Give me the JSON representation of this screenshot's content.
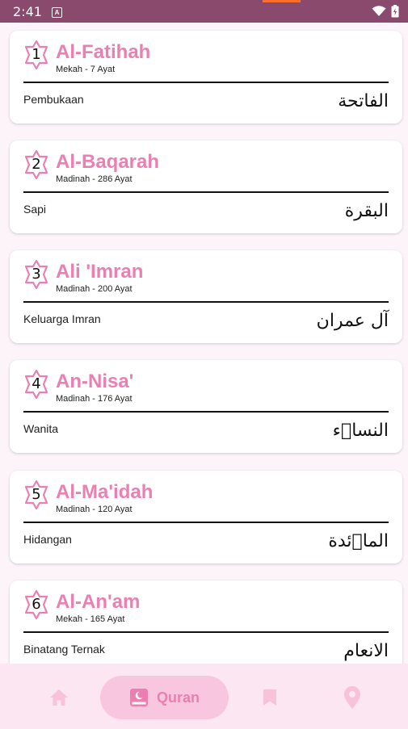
{
  "status_bar": {
    "time": "2:41",
    "notification_icon": "A"
  },
  "surahs": [
    {
      "number": "1",
      "name": "Al-Fatihah",
      "info": "Mekah - 7 Ayat",
      "meaning": "Pembukaan",
      "arabic": "الفاتحة"
    },
    {
      "number": "2",
      "name": "Al-Baqarah",
      "info": "Madinah - 286 Ayat",
      "meaning": "Sapi",
      "arabic": "البقرة"
    },
    {
      "number": "3",
      "name": "Ali 'Imran",
      "info": "Madinah - 200 Ayat",
      "meaning": "Keluarga Imran",
      "arabic": "آل عمران"
    },
    {
      "number": "4",
      "name": "An-Nisa'",
      "info": "Madinah - 176 Ayat",
      "meaning": "Wanita",
      "arabic": "النساۤء"
    },
    {
      "number": "5",
      "name": "Al-Ma'idah",
      "info": "Madinah - 120 Ayat",
      "meaning": "Hidangan",
      "arabic": "الماۤئدة"
    },
    {
      "number": "6",
      "name": "Al-An'am",
      "info": "Mekah - 165 Ayat",
      "meaning": "Binatang Ternak",
      "arabic": "الانعام"
    }
  ],
  "nav": {
    "items": [
      {
        "icon": "home-icon"
      },
      {
        "icon": "quran-book-icon",
        "label": "Quran",
        "active": true
      },
      {
        "icon": "bookmark-icon"
      },
      {
        "icon": "location-pin-icon"
      }
    ]
  },
  "colors": {
    "accent": "#ec7fb2",
    "status_bar": "#8a4a6e",
    "nav_bg": "#fce6f1",
    "pill": "#f8c7df"
  }
}
